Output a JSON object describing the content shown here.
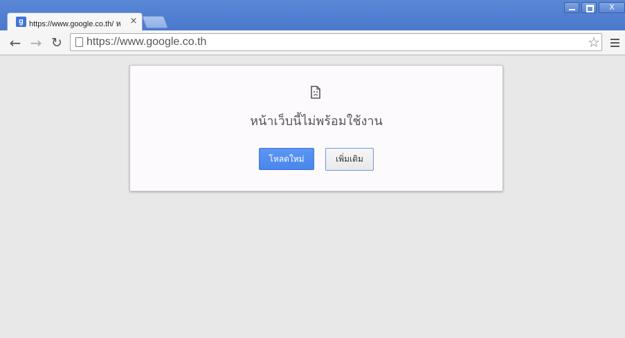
{
  "tab": {
    "favicon_letter": "g",
    "title": "https://www.google.co.th/ ห",
    "close_glyph": "×"
  },
  "window_controls": {
    "minimize": "",
    "maximize": "",
    "close": "X"
  },
  "toolbar": {
    "back_glyph": "←",
    "forward_glyph": "→",
    "reload_glyph": "↻",
    "url": "https://www.google.co.th",
    "bookmark_glyph": "☆"
  },
  "error_page": {
    "title": "หน้าเว็บนี้ไม่พร้อมใช้งาน",
    "reload_label": "โหลดใหม่",
    "more_label": "เพิ่มเติม"
  },
  "colors": {
    "frame_blue": "#4a78cc",
    "primary_button": "#4a86ec",
    "page_background": "#e8e8e8"
  }
}
